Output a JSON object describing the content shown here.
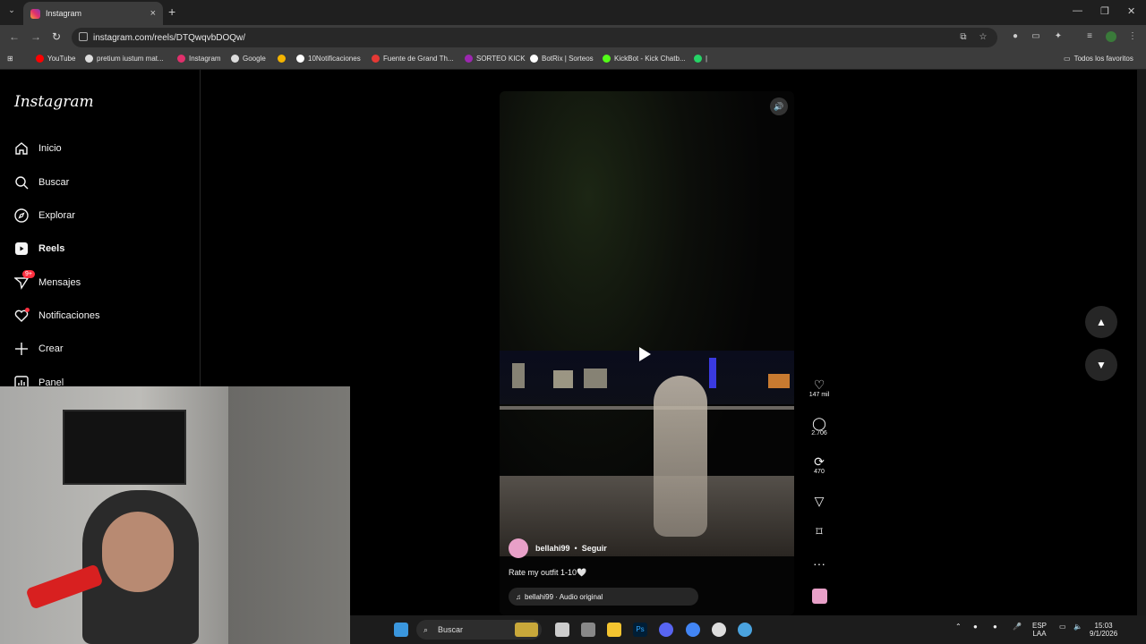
{
  "browser": {
    "tab_title": "Instagram",
    "url": "instagram.com/reels/DTQwqvbDOQw/",
    "bookmarks": [
      {
        "label": "YouTube",
        "color": "#ff0000"
      },
      {
        "label": "pretium iustum mat...",
        "color": "#dddddd"
      },
      {
        "label": "Instagram",
        "color": "#e1306c"
      },
      {
        "label": "Google",
        "color": "#dddddd"
      },
      {
        "label": "",
        "color": "#f4b400"
      },
      {
        "label": "10Notificaciones",
        "color": "#ffffff"
      },
      {
        "label": "Fuente de Grand Th...",
        "color": "#e53935"
      },
      {
        "label": "SORTEO KICK",
        "color": "#9c27b0"
      },
      {
        "label": "BotRix | Sorteos",
        "color": "#ffffff"
      },
      {
        "label": "KickBot - Kick Chatb...",
        "color": "#53fc18"
      },
      {
        "label": "|",
        "color": "#25d366"
      }
    ],
    "all_favorites": "Todos los favoritos"
  },
  "sidebar": {
    "logo": "Instagram",
    "items": [
      {
        "label": "Inicio",
        "icon": "home-icon"
      },
      {
        "label": "Buscar",
        "icon": "search-icon"
      },
      {
        "label": "Explorar",
        "icon": "compass-icon"
      },
      {
        "label": "Reels",
        "icon": "reels-icon"
      },
      {
        "label": "Mensajes",
        "icon": "messenger-icon",
        "badge": "9+"
      },
      {
        "label": "Notificaciones",
        "icon": "heart-icon"
      },
      {
        "label": "Crear",
        "icon": "plus-icon"
      },
      {
        "label": "Panel",
        "icon": "chart-icon"
      }
    ]
  },
  "reel": {
    "username": "bellahi99",
    "separator": "•",
    "follow": "Seguir",
    "caption": "Rate my outfit 1-10🤍",
    "audio": "bellahi99 · Audio original"
  },
  "actions": {
    "likes": "147 mil",
    "comments": "2.706",
    "reposts": "470"
  },
  "taskbar": {
    "search_placeholder": "Buscar",
    "lang_top": "ESP",
    "lang_bottom": "LAA",
    "time": "15:03",
    "date": "9/1/2026"
  }
}
